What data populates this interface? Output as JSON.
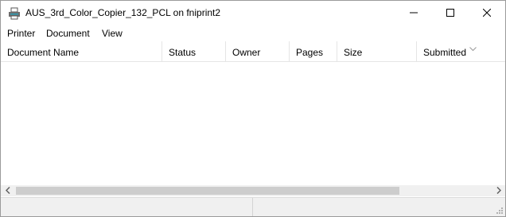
{
  "window": {
    "title": "AUS_3rd_Color_Copier_132_PCL on fniprint2"
  },
  "icons": {
    "app": "printer-icon",
    "minimize": "minimize-icon",
    "maximize": "maximize-icon",
    "close": "close-icon",
    "sort": "chevron-down-icon",
    "scroll_left": "chevron-left-icon",
    "scroll_right": "chevron-right-icon",
    "grip": "resize-grip-icon"
  },
  "menu": {
    "items": [
      {
        "label": "Printer"
      },
      {
        "label": "Document"
      },
      {
        "label": "View"
      }
    ]
  },
  "queue": {
    "columns": [
      {
        "label": "Document Name"
      },
      {
        "label": "Status"
      },
      {
        "label": "Owner"
      },
      {
        "label": "Pages"
      },
      {
        "label": "Size"
      },
      {
        "label": "Submitted"
      }
    ],
    "rows": []
  },
  "statusbar": {
    "left": "",
    "right": ""
  },
  "colors": {
    "window_border": "#9a9a9a",
    "scrollbar_track": "#f0f0f0",
    "scrollbar_thumb": "#cdcdcd",
    "statusbar_bg": "#f0f0f0",
    "icon_accent": "#2aa0b8"
  }
}
